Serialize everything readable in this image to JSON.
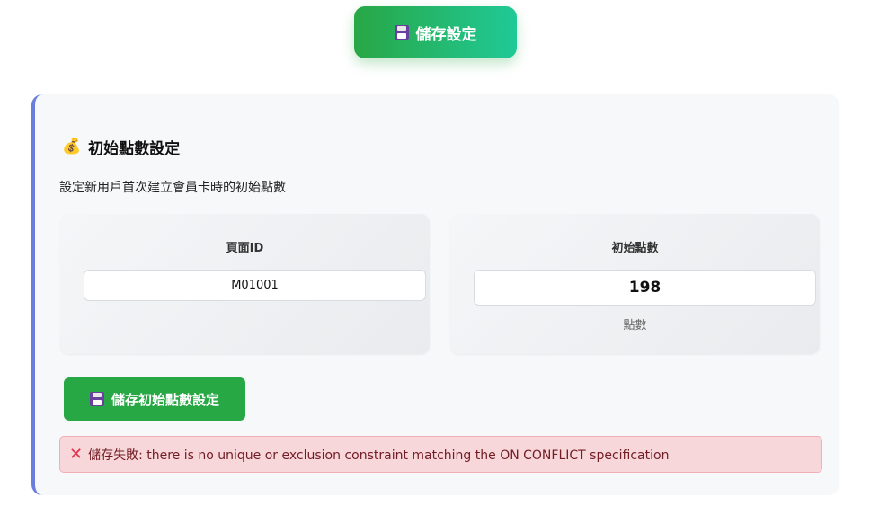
{
  "top_bar": {
    "save_label": "儲存設定",
    "save_icon": "floppy-disk-icon"
  },
  "initial_points": {
    "title_icon": "money-bag-icon",
    "title": "初始點數設定",
    "description": "設定新用戶首次建立會員卡時的初始點數",
    "page_id": {
      "label": "頁面ID",
      "value": "M01001"
    },
    "points": {
      "label": "初始點數",
      "value": "198",
      "unit": "點數"
    },
    "save_label": "儲存初始點數設定",
    "error_icon": "x-icon",
    "error_message": "儲存失敗: there is no unique or exclusion constraint matching the ON CONFLICT specification"
  },
  "colors": {
    "accent_green": "#28a745",
    "accent_teal": "#20c997",
    "card_border": "#6a7fdb",
    "error_bg": "#f8d7da",
    "error_text": "#721c24"
  }
}
